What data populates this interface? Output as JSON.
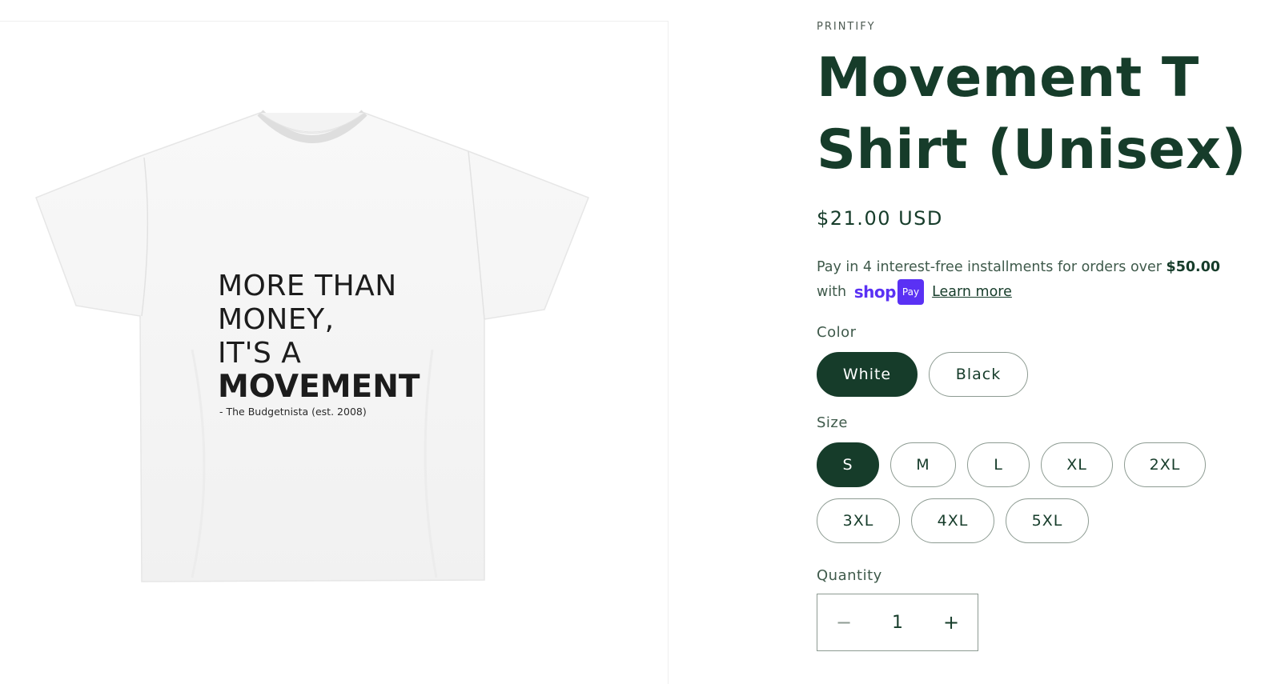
{
  "product": {
    "vendor": "PRINTIFY",
    "title": "Movement T Shirt (Unisex)",
    "price": "$21.00 USD",
    "image": {
      "print_lines": [
        "MORE  THAN",
        "MONEY,",
        "IT'S A"
      ],
      "print_strong": "MOVEMENT",
      "print_credit": "- The Budgetnista (est. 2008)"
    }
  },
  "installments": {
    "text": "Pay in 4 interest-free installments for orders over ",
    "threshold": "$50.00",
    "with": "with",
    "shop_logo": "shop",
    "pay_badge": "Pay",
    "learn_more": "Learn more"
  },
  "options": {
    "color": {
      "label": "Color",
      "values": [
        "White",
        "Black"
      ],
      "selected": "White"
    },
    "size": {
      "label": "Size",
      "values": [
        "S",
        "M",
        "L",
        "XL",
        "2XL",
        "3XL",
        "4XL",
        "5XL"
      ],
      "selected": "S"
    }
  },
  "quantity": {
    "label": "Quantity",
    "value": "1",
    "minus_label": "−",
    "plus_label": "+"
  },
  "colors": {
    "brand_green": "#163c2a",
    "shop_purple": "#5a31f4",
    "pill_border": "#8d9b92"
  }
}
